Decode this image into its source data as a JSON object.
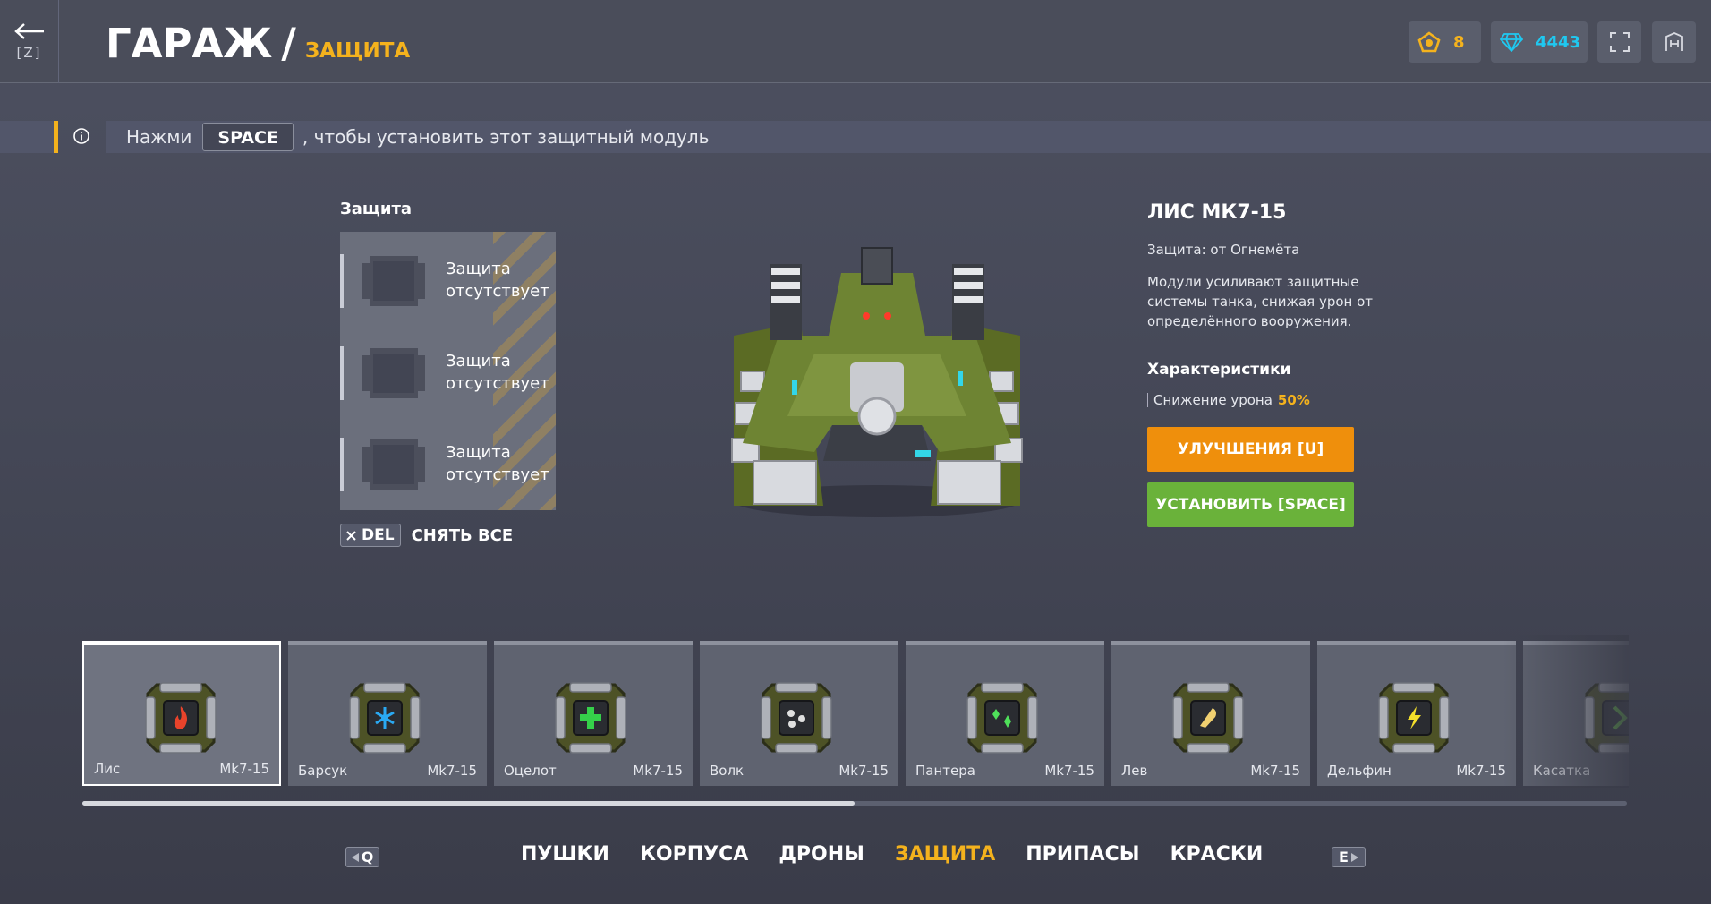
{
  "header": {
    "back_key": "[Z]",
    "title": "ГАРАЖ",
    "separator": "/",
    "subtitle": "ЗАЩИТА",
    "crystals": "8",
    "gems": "4443"
  },
  "hint": {
    "pre": "Нажми",
    "key": "SPACE",
    "post": ", чтобы установить этот защитный модуль"
  },
  "slots": {
    "label": "Защита",
    "items": [
      {
        "text": "Защита отсутствует"
      },
      {
        "text": "Защита отсутствует"
      },
      {
        "text": "Защита отсутствует"
      }
    ],
    "del_key": "DEL",
    "remove_all": "СНЯТЬ ВСЕ"
  },
  "details": {
    "name": "ЛИС МК7-15",
    "protection_type": "Защита: от Огнемёта",
    "description": "Модули усиливают защитные системы танка, снижая урон от определённого вооружения.",
    "characteristics_label": "Характеристики",
    "stat_label": "Снижение урона",
    "stat_value": "50%",
    "upgrade_button": "УЛУЧШЕНИЯ [U]",
    "install_button": "УСТАНОВИТЬ [SPACE]"
  },
  "modules": [
    {
      "name": "Лис",
      "level": "Mk7-15",
      "icon": "flame-icon",
      "color": "#e8432b"
    },
    {
      "name": "Барсук",
      "level": "Mk7-15",
      "icon": "snowflake-icon",
      "color": "#2aa9f2"
    },
    {
      "name": "Оцелот",
      "level": "Mk7-15",
      "icon": "plus-icon",
      "color": "#35d04a"
    },
    {
      "name": "Волк",
      "level": "Mk7-15",
      "icon": "dots-icon",
      "color": "#e0e0e0"
    },
    {
      "name": "Пантера",
      "level": "Mk7-15",
      "icon": "sparks-icon",
      "color": "#4fe05a"
    },
    {
      "name": "Лев",
      "level": "Mk7-15",
      "icon": "feather-icon",
      "color": "#f0d070"
    },
    {
      "name": "Дельфин",
      "level": "Mk7-15",
      "icon": "lightning-icon",
      "color": "#f4e02a"
    },
    {
      "name": "Касатка",
      "level": "",
      "icon": "chevron-icon",
      "color": "#6bdc3c"
    }
  ],
  "scroll_fraction": 0.5,
  "tabs": [
    "ПУШКИ",
    "КОРПУСА",
    "ДРОНЫ",
    "ЗАЩИТА",
    "ПРИПАСЫ",
    "КРАСКИ"
  ],
  "active_tab": "ЗАЩИТА",
  "tab_keys": {
    "prev": "Q",
    "next": "E"
  },
  "colors": {
    "accent": "#f4b21d",
    "gems": "#1fc8f0",
    "upgrade": "#ef8f0c",
    "install": "#6ab23a"
  }
}
